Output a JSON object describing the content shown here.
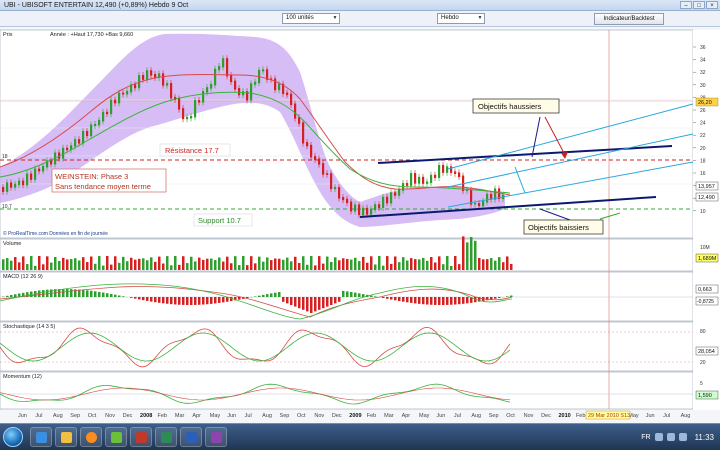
{
  "window": {
    "title": "UBI - UBISOFT ENTERTAIN   12,490  (+0,89%)   Hebdo   9 Oct",
    "controls": [
      "–",
      "□",
      "×"
    ]
  },
  "toolbar": {
    "units_select": "100 unités",
    "period_select": "Hebdo",
    "indicator_button": "Indicateur/Backtest"
  },
  "price_panel": {
    "label": "Prix",
    "ohlc_info": "Année : +Haut 17,730 +Bas 9,660",
    "source": "© ProRealTime.com  Données en fin de journée",
    "y_ticks": [
      "36",
      "34",
      "32",
      "30",
      "28",
      "26",
      "24",
      "22",
      "20",
      "18",
      "16",
      "14",
      "12",
      "10"
    ],
    "price_tags": [
      {
        "text": "26,20",
        "color": "#ffd24a"
      },
      {
        "text": "13,957",
        "color": "#ffffff"
      },
      {
        "text": "12,490",
        "color": "#ffffff"
      }
    ],
    "left_level_labels": [
      "18",
      "10.7"
    ]
  },
  "annotations": {
    "resistance": "Résistance 17.7",
    "weinstein_line1": "WEINSTEIN: Phase 3",
    "weinstein_line2": "Sans tendance moyen terme",
    "support": "Support 10.7",
    "targets_up": "Objectifs haussiers",
    "targets_down": "Objectifs baissiers"
  },
  "indicator_panels": {
    "volume": {
      "label": "Volume",
      "tag": "1,689M",
      "tick": "10M"
    },
    "macd": {
      "label": "MACD (12 26 9)",
      "tags": [
        "0,663",
        "-0,8725"
      ]
    },
    "stochastic": {
      "label": "Stochastique (14 3 5)",
      "tag": "28,054",
      "ticks": [
        "80",
        "20"
      ]
    },
    "momentum": {
      "label": "Momentum (12)",
      "tag": "1,590",
      "tick": "5"
    }
  },
  "time_axis": {
    "labels": [
      "Jun",
      "Jul",
      "Aug",
      "Sep",
      "Oct",
      "Nov",
      "Dec",
      "2008",
      "Feb",
      "Mar",
      "Apr",
      "May",
      "Jun",
      "Jul",
      "Aug",
      "Sep",
      "Oct",
      "Nov",
      "Dec",
      "2009",
      "Feb",
      "Mar",
      "Apr",
      "May",
      "Jun",
      "Jul",
      "Aug",
      "Sep",
      "Oct",
      "Nov",
      "Dec",
      "2010",
      "Feb",
      "Mar",
      "Apr",
      "May",
      "Jun",
      "Jul",
      "Aug"
    ],
    "cursor_date": "29 Mar 2010 S13"
  },
  "colors": {
    "up_candle": "#2e9e2e",
    "down_candle": "#d42020",
    "bollinger_fill": "#c9a7f2",
    "ma_short": "#d84b4b",
    "ma_long": "#3bb33b",
    "channel_up": "#2aa8e0",
    "channel_main": "#0b1a6e"
  },
  "taskbar": {
    "lang": "FR",
    "clock": "11:33"
  }
}
